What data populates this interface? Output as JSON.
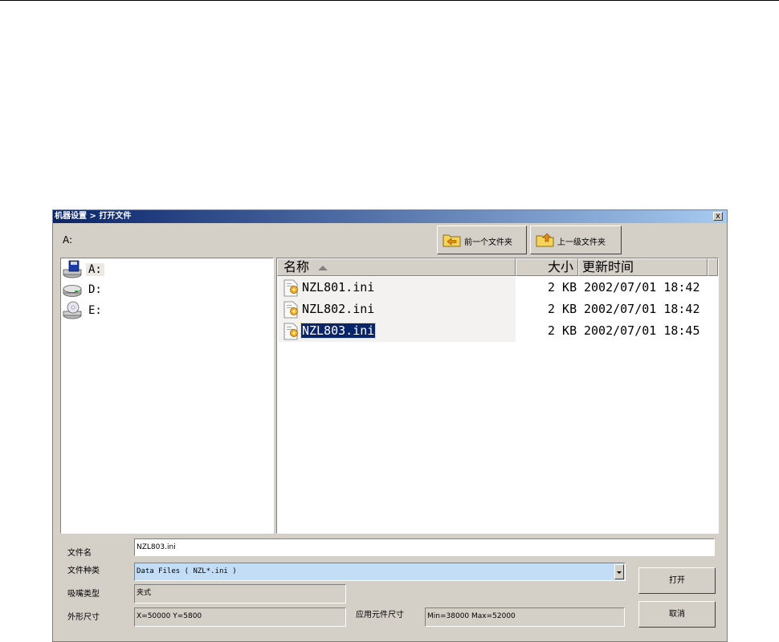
{
  "dialog": {
    "title": "机器设置 > 打开文件",
    "close_label": "x",
    "current_path": "A:"
  },
  "toolbar": {
    "back_label": "前一个文件夹",
    "up_label": "上一级文件夹"
  },
  "drives": [
    {
      "label": "A:",
      "icon": "floppy-drive-icon"
    },
    {
      "label": "D:",
      "icon": "hard-drive-icon"
    },
    {
      "label": "E:",
      "icon": "cd-drive-icon"
    }
  ],
  "columns": {
    "name": "名称",
    "size": "大小",
    "modified": "更新时间"
  },
  "files": [
    {
      "name": "NZL801.ini",
      "size": "2 KB",
      "modified": "2002/07/01 18:42",
      "icon": "ini-file-icon"
    },
    {
      "name": "NZL802.ini",
      "size": "2 KB",
      "modified": "2002/07/01 18:42",
      "icon": "ini-file-icon"
    },
    {
      "name": "NZL803.ini",
      "size": "2 KB",
      "modified": "2002/07/01 18:45",
      "icon": "ini-file-icon"
    }
  ],
  "form": {
    "filename_label": "文件名",
    "filename_value": "NZL803.ini",
    "filetype_label": "文件种类",
    "filetype_value": "Data Files ( NZL*.ini )",
    "nozzle_type_label": "吸嘴类型",
    "nozzle_type_value": "夹式",
    "outline_label": "外形尺寸",
    "outline_value": "X=50000 Y=5800",
    "component_size_label": "应用元件尺寸",
    "component_size_value": "Min=38000 Max=52000"
  },
  "actions": {
    "open_label": "打开",
    "cancel_label": "取消"
  },
  "colors": {
    "titlebar": "#0a246a",
    "dialog_bg": "#d4d0c8",
    "selection": "#0a246a",
    "filetype_bg": "#c4ddf7"
  }
}
